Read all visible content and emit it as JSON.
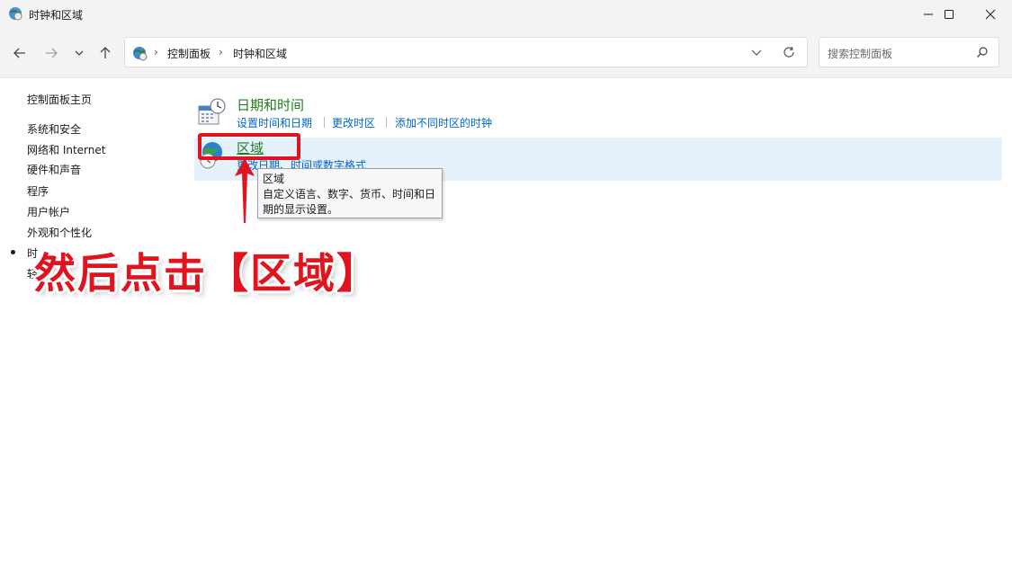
{
  "window": {
    "title": "时钟和区域",
    "controls": [
      "minimize-icon",
      "maximize-icon",
      "close-icon"
    ]
  },
  "toolbar": {
    "nav_icons": [
      "back-arrow-icon",
      "forward-arrow-icon",
      "recent-dropdown-icon",
      "up-arrow-icon"
    ],
    "breadcrumb": [
      "控制面板",
      "时钟和区域"
    ],
    "search_placeholder": "搜索控制面板"
  },
  "sidebar": {
    "home": "控制面板主页",
    "items": [
      {
        "label": "系统和安全"
      },
      {
        "label": "网络和 Internet"
      },
      {
        "label": "硬件和声音"
      },
      {
        "label": "程序"
      },
      {
        "label": "用户帐户"
      },
      {
        "label": "外观和个性化"
      },
      {
        "label": "时"
      },
      {
        "label": "轻"
      }
    ]
  },
  "categories": [
    {
      "title": "日期和时间",
      "icon": "calendar-clock-icon",
      "links": [
        "设置时间和日期",
        "更改时区",
        "添加不同时区的时钟"
      ]
    },
    {
      "title": "区域",
      "icon": "globe-clock-icon",
      "links": [
        "更改日期、时间或数字格式"
      ]
    }
  ],
  "tooltip": {
    "title": "区域",
    "line1": "自定义语言、数字、货币、时间和日",
    "line2": "期的显示设置。"
  },
  "annotation": {
    "text": "然后点击【区域】",
    "color": "#e0141f"
  },
  "colors": {
    "category_title": "#1e7d1e",
    "link": "#0066cc",
    "hover_row": "#e5f1fb",
    "annotation": "#e0141f"
  }
}
